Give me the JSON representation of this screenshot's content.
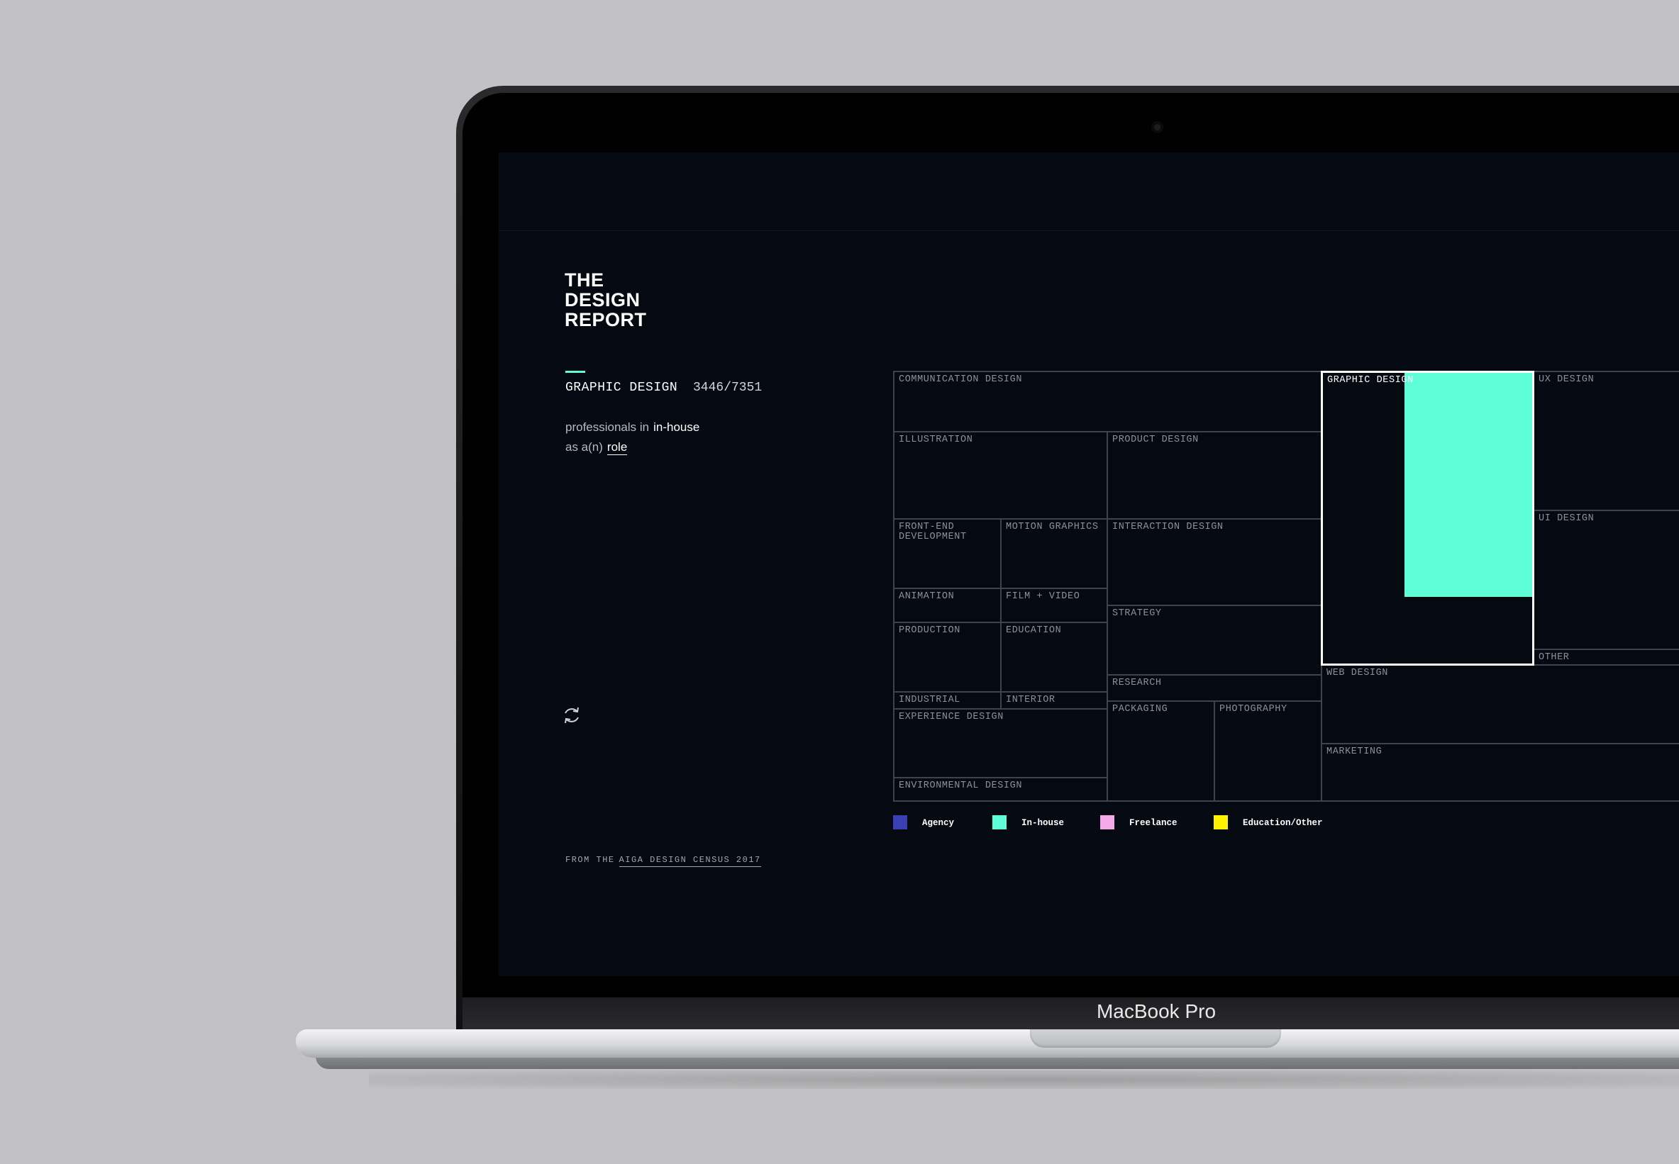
{
  "device": {
    "brand_label": "MacBook Pro"
  },
  "app": {
    "logo_lines": [
      "THE",
      "DESIGN",
      "REPORT"
    ],
    "selected_role": "GRAPHIC DESIGN",
    "count": "3446/7351",
    "desc_prefix": "professionals in",
    "employment_type": "in-house",
    "desc_mid": "as a(n)",
    "role_word": "role",
    "credit_prefix": "FROM THE",
    "credit_link": "AIGA DESIGN CENSUS 2017",
    "accent_color": "#5effd8"
  },
  "treemap": {
    "highlight_fraction": "3446/7351",
    "cells": [
      {
        "id": "communication-design",
        "label": "COMMUNICATION DESIGN"
      },
      {
        "id": "graphic-design",
        "label": "GRAPHIC DESIGN",
        "active": true
      },
      {
        "id": "ux-design",
        "label": "UX DESIGN"
      },
      {
        "id": "illustration",
        "label": "ILLUSTRATION"
      },
      {
        "id": "product-design",
        "label": "PRODUCT DESIGN"
      },
      {
        "id": "ui-design",
        "label": "UI DESIGN"
      },
      {
        "id": "front-end-development",
        "label": "FRONT-END\nDEVELOPMENT"
      },
      {
        "id": "motion-graphics",
        "label": "MOTION GRAPHICS"
      },
      {
        "id": "interaction-design",
        "label": "INTERACTION DESIGN"
      },
      {
        "id": "animation",
        "label": "ANIMATION"
      },
      {
        "id": "film-video",
        "label": "FILM + VIDEO"
      },
      {
        "id": "strategy",
        "label": "STRATEGY"
      },
      {
        "id": "production",
        "label": "PRODUCTION"
      },
      {
        "id": "education",
        "label": "EDUCATION"
      },
      {
        "id": "other",
        "label": "OTHER"
      },
      {
        "id": "research",
        "label": "RESEARCH"
      },
      {
        "id": "web-design",
        "label": "WEB DESIGN"
      },
      {
        "id": "industrial",
        "label": "INDUSTRIAL"
      },
      {
        "id": "interior",
        "label": "INTERIOR"
      },
      {
        "id": "experience-design",
        "label": "EXPERIENCE DESIGN"
      },
      {
        "id": "packaging",
        "label": "PACKAGING"
      },
      {
        "id": "photography",
        "label": "PHOTOGRAPHY"
      },
      {
        "id": "marketing",
        "label": "MARKETING"
      },
      {
        "id": "environmental-design",
        "label": "ENVIRONMENTAL DESIGN"
      }
    ]
  },
  "legend": [
    {
      "label": "Agency",
      "color": "#3a3fb4"
    },
    {
      "label": "In-house",
      "color": "#5effd8"
    },
    {
      "label": "Freelance",
      "color": "#f5a8e8"
    },
    {
      "label": "Education/Other",
      "color": "#fff200"
    }
  ]
}
